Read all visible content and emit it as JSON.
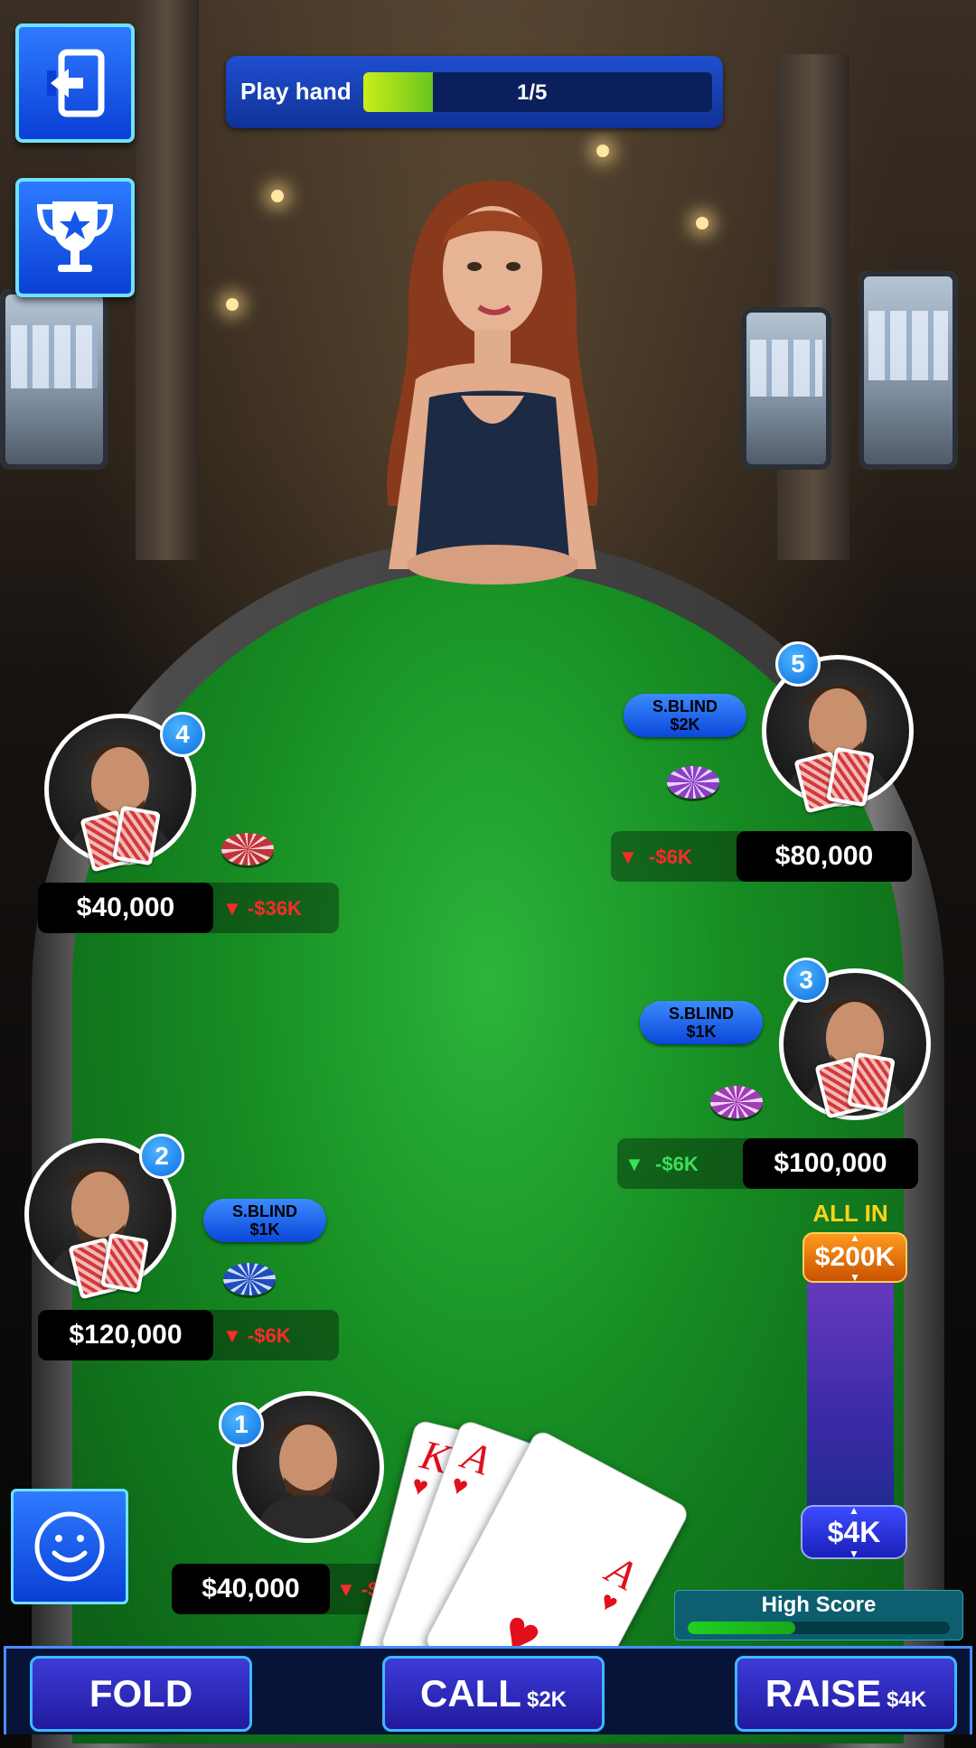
{
  "hud": {
    "progress_label": "Play hand",
    "progress_text": "1/5",
    "progress_fraction": 0.2
  },
  "icons": {
    "exit": "exit-door-icon",
    "trophy": "trophy-star-icon",
    "emoji": "smiley-icon"
  },
  "players": [
    {
      "seat": "4",
      "chips": "$40,000",
      "delta": "-$36K",
      "delta_dir": "down"
    },
    {
      "seat": "5",
      "chips": "$80,000",
      "delta": "-$6K",
      "delta_dir": "down",
      "blind": "S.BLIND\n$2K"
    },
    {
      "seat": "3",
      "chips": "$100,000",
      "delta": "-$6K",
      "delta_dir": "up",
      "blind": "S.BLIND\n$1K"
    },
    {
      "seat": "2",
      "chips": "$120,000",
      "delta": "-$6K",
      "delta_dir": "down",
      "blind": "S.BLIND\n$1K"
    },
    {
      "seat": "1",
      "chips": "$40,000",
      "delta": "-$",
      "delta_dir": "down"
    }
  ],
  "blinds": {
    "p5_line1": "S.BLIND",
    "p5_line2": "$2K",
    "p3_line1": "S.BLIND",
    "p3_line2": "$1K",
    "p2_line1": "S.BLIND",
    "p2_line2": "$1K"
  },
  "hand": [
    {
      "rank": "K",
      "suit": "♥"
    },
    {
      "rank": "A",
      "suit": "♥"
    },
    {
      "rank": "A",
      "suit": "♥"
    }
  ],
  "raise_slider": {
    "allin_label": "ALL IN",
    "max_value": "$200K",
    "current_value": "$4K"
  },
  "high_score": {
    "label": "High Score",
    "fraction": 0.41
  },
  "actions": {
    "fold": "FOLD",
    "call": "CALL",
    "call_amount": "$2K",
    "raise": "RAISE",
    "raise_amount": "$4K"
  },
  "colors": {
    "felt": "#168a22",
    "button_blue": "#0a3fd6",
    "negative": "#ff2a2a",
    "positive": "#3ae05a",
    "allin": "#ffd21a"
  }
}
